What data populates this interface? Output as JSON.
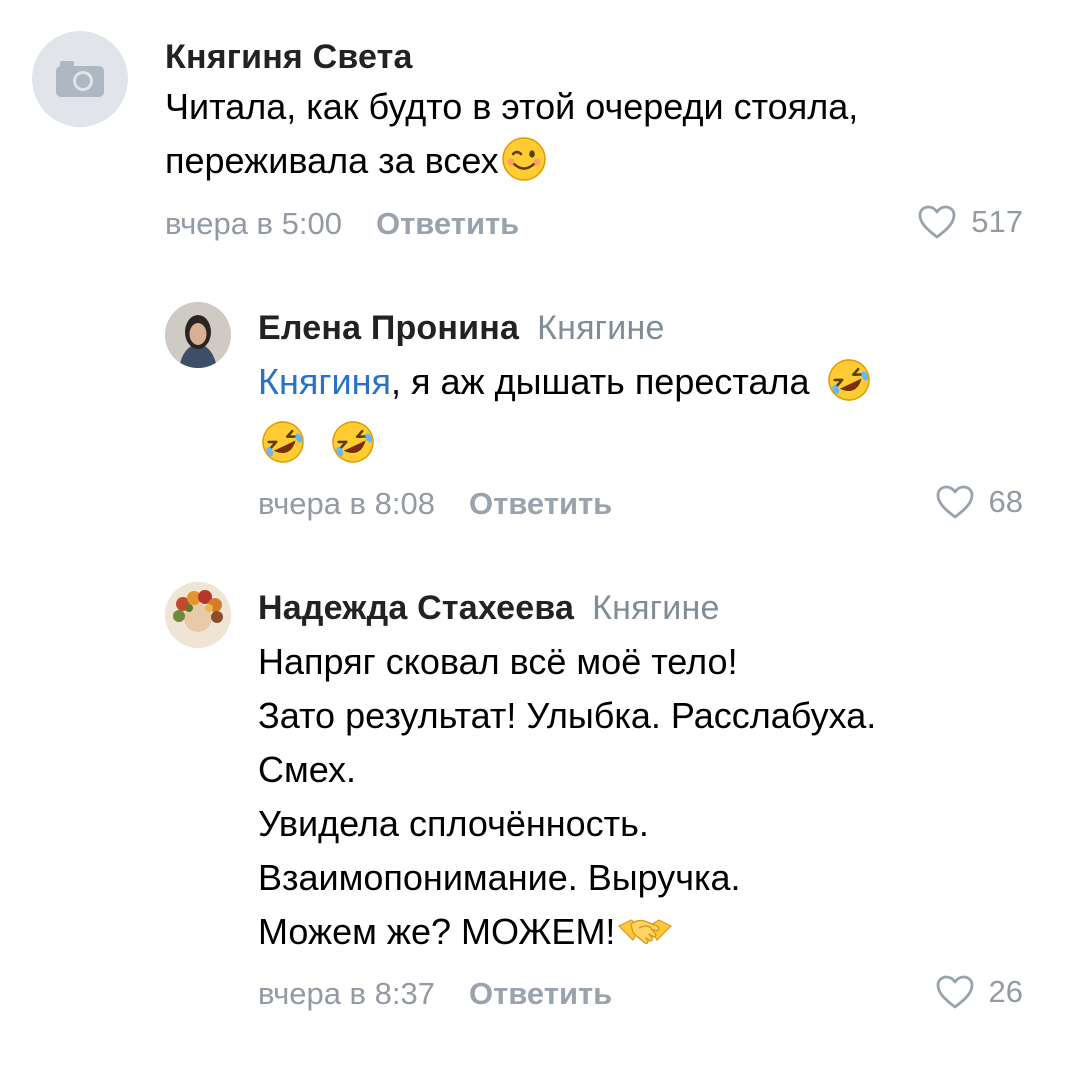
{
  "comments": [
    {
      "author": "Княгиня Света",
      "reply_to": "",
      "lines": [
        "Читала, как будто в этой очереди стояла,",
        "переживала за всех"
      ],
      "time": "вчера в 5:00",
      "reply_label": "Ответить",
      "likes": "517",
      "avatar": "camera-placeholder-icon"
    },
    {
      "author": "Елена Пронина",
      "reply_to": "Княгине",
      "mention": "Княгиня",
      "lines": [
        ", я аж дышать перестала"
      ],
      "time": "вчера в 8:08",
      "reply_label": "Ответить",
      "likes": "68",
      "avatar": "user-photo"
    },
    {
      "author": "Надежда Стахеева",
      "reply_to": "Княгине",
      "lines": [
        "Напряг сковал всё моё тело!",
        "Зато результат! Улыбка. Расслабуха.",
        "Смех.",
        "Увидела сплочённость.",
        "Взаимопонимание. Выручка.",
        "Можем же? МОЖЕМ!"
      ],
      "time": "вчера в 8:37",
      "reply_label": "Ответить",
      "likes": "26",
      "avatar": "user-photo"
    }
  ],
  "colors": {
    "author": "#222222",
    "meta": "#939aa3",
    "mention": "#2a72c6",
    "placeholder": "#e1e5eb"
  }
}
